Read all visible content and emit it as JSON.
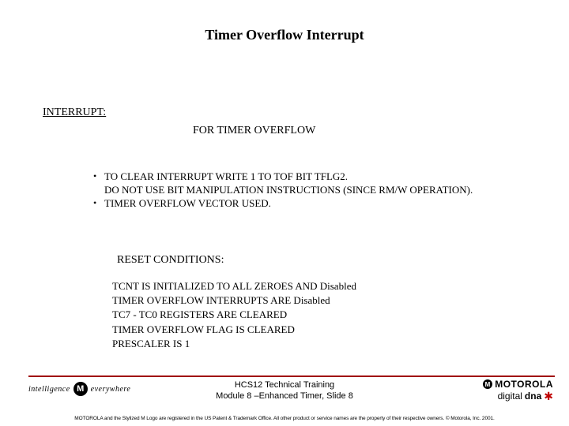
{
  "title": "Timer Overflow Interrupt",
  "interrupt_label": "INTERRUPT:",
  "subtitle": "FOR TIMER OVERFLOW",
  "bullets": [
    {
      "line": "TO CLEAR INTERRUPT WRITE 1 TO TOF BIT TFLG2.",
      "cont": "DO NOT USE BIT MANIPULATION INSTRUCTIONS (SINCE RM/W OPERATION)."
    },
    {
      "line": "TIMER OVERFLOW VECTOR USED."
    }
  ],
  "reset_label": "RESET CONDITIONS:",
  "reset_lines": [
    "TCNT IS INITIALIZED TO ALL ZEROES AND Disabled",
    "TIMER OVERFLOW INTERRUPTS ARE Disabled",
    "TC7 - TC0 REGISTERS ARE CLEARED",
    "TIMER OVERFLOW FLAG IS CLEARED",
    "PRESCALER IS 1"
  ],
  "footer": {
    "line1": "HCS12 Technical Training",
    "line2": "Module 8 –Enhanced Timer, Slide 8"
  },
  "logo_left": {
    "word1": "intelligence",
    "word2": "everywhere",
    "m": "M"
  },
  "logo_right": {
    "brand": "MOTOROLA",
    "m": "M",
    "dna1": "digital",
    "dna2": "dna"
  },
  "fineprint": "MOTOROLA and the Stylized M Logo are registered in the US Patent & Trademark Office. All other product or service names are the property of their respective owners. © Motorola, Inc. 2001."
}
